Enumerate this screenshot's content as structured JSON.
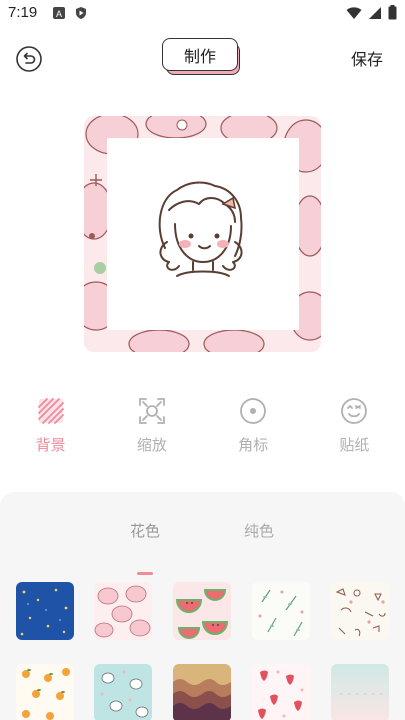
{
  "status_bar": {
    "time": "7:19"
  },
  "top_bar": {
    "title": "制作",
    "save_label": "保存"
  },
  "tools": [
    {
      "label": "背景",
      "icon": "stripes-icon",
      "active": true
    },
    {
      "label": "缩放",
      "icon": "scale-frame-icon",
      "active": false
    },
    {
      "label": "角标",
      "icon": "corner-mark-icon",
      "active": false
    },
    {
      "label": "贴纸",
      "icon": "smiley-sticker-icon",
      "active": false
    }
  ],
  "panel": {
    "tabs": [
      {
        "label": "花色",
        "active": true
      },
      {
        "label": "纯色",
        "active": false
      }
    ],
    "swatches_row1": [
      "blue-starry",
      "pink-bubbles",
      "watermelon",
      "leaf-sprigs",
      "doodle-scatter"
    ],
    "swatches_row2": [
      "orange-fruit",
      "teal-cats",
      "wave-layers",
      "strawberry",
      "pastel-gradient"
    ]
  },
  "colors": {
    "accent_pink": "#f08a9c",
    "inactive_grey": "#b0b0b0",
    "panel_bg": "#f6f6f6"
  }
}
